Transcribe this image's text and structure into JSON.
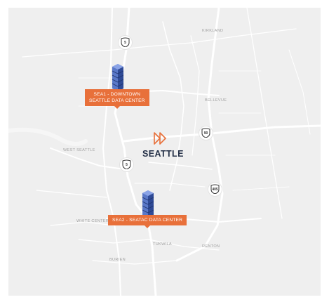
{
  "map": {
    "colors": {
      "land": "#efefef",
      "road": "#ffffff",
      "accent": "#e8703a",
      "city": "#243047",
      "server": "#3f5fb0"
    },
    "places": {
      "kirkland": "KIRKLAND",
      "bellevue": "BELLEVUE",
      "west_seattle": "WEST SEATTLE",
      "white_center": "WHITE CENTER",
      "tukwila": "TUKWILA",
      "renton": "RENTON",
      "burien": "BURIEN"
    },
    "city": {
      "name": "SEATTLE",
      "logo_icon": "fast-forward-logo-icon"
    },
    "highways": {
      "i5_north": "5",
      "i5_south": "5",
      "i90": "90",
      "i405": "405"
    },
    "data_centers": {
      "sea1": {
        "line1": "SEA1 - DOWNTOWN",
        "line2": "SEATTLE DATA CENTER",
        "icon": "server-stack-icon"
      },
      "sea2": {
        "line1": "SEA2 - SEATAC DATA CENTER",
        "icon": "server-stack-icon"
      }
    }
  }
}
